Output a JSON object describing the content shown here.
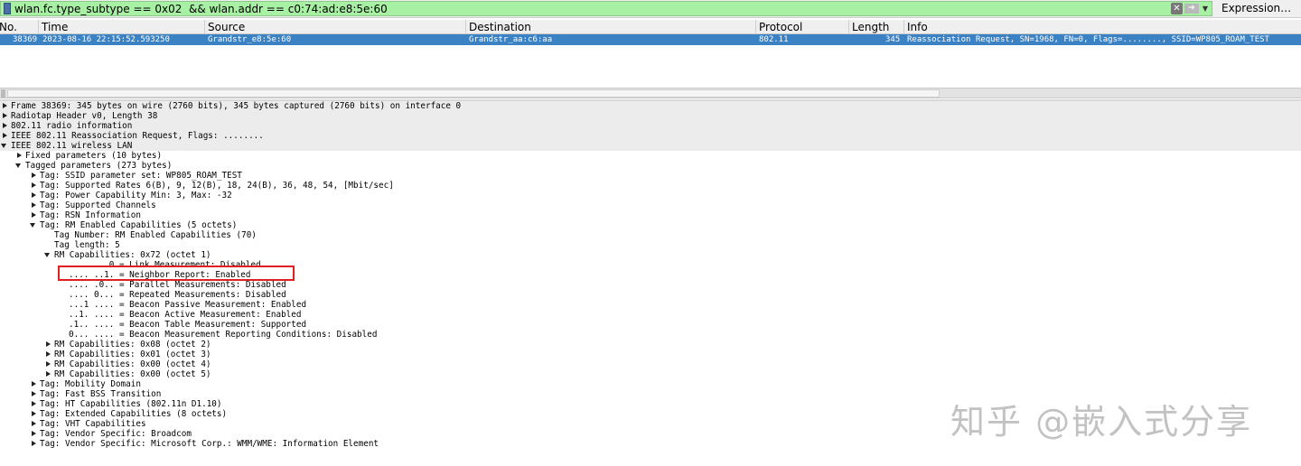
{
  "filter": {
    "value": "wlan.fc.type_subtype == 0x02  && wlan.addr == c0:74:ad:e8:5e:60",
    "expression_label": "Expression…"
  },
  "packet_list": {
    "columns": [
      "No.",
      "Time",
      "Source",
      "Destination",
      "Protocol",
      "Length",
      "Info"
    ],
    "rows": [
      {
        "no": "38369",
        "time": "2023-08-16 22:15:52.593250",
        "source": "Grandstr_e8:5e:60",
        "destination": "Grandstr_aa:c6:aa",
        "protocol": "802.11",
        "length": "345",
        "info": "Reassociation Request, SN=1968, FN=0, Flags=........, SSID=WP805_ROAM_TEST"
      }
    ]
  },
  "details": [
    {
      "text": "Frame 38369: 345 bytes on wire (2760 bits), 345 bytes captured (2760 bits) on interface 0",
      "arrow": "right",
      "level": 0
    },
    {
      "text": "Radiotap Header v0, Length 38",
      "arrow": "right",
      "level": 0
    },
    {
      "text": "802.11 radio information",
      "arrow": "right",
      "level": 0
    },
    {
      "text": "IEEE 802.11 Reassociation Request, Flags: ........",
      "arrow": "right",
      "level": 0
    },
    {
      "text": "IEEE 802.11 wireless LAN",
      "arrow": "down",
      "level": 0
    },
    {
      "text": "Fixed parameters (10 bytes)",
      "arrow": "right",
      "level": 1
    },
    {
      "text": "Tagged parameters (273 bytes)",
      "arrow": "down",
      "level": 1
    },
    {
      "text": "Tag: SSID parameter set: WP805_ROAM_TEST",
      "arrow": "right",
      "level": 2
    },
    {
      "text": "Tag: Supported Rates 6(B), 9, 12(B), 18, 24(B), 36, 48, 54, [Mbit/sec]",
      "arrow": "right",
      "level": 2
    },
    {
      "text": "Tag: Power Capability Min: 3, Max: -32",
      "arrow": "right",
      "level": 2
    },
    {
      "text": "Tag: Supported Channels",
      "arrow": "right",
      "level": 2
    },
    {
      "text": "Tag: RSN Information",
      "arrow": "right",
      "level": 2
    },
    {
      "text": "Tag: RM Enabled Capabilities (5 octets)",
      "arrow": "down",
      "level": 2
    },
    {
      "text": "Tag Number: RM Enabled Capabilities (70)",
      "arrow": "none",
      "level": 3
    },
    {
      "text": "Tag length: 5",
      "arrow": "none",
      "level": 3
    },
    {
      "text": "RM Capabilities: 0x72 (octet 1)",
      "arrow": "down",
      "level": 3
    },
    {
      "text": ".... ...0 = Link Measurement: Disabled",
      "arrow": "none",
      "level": 4
    },
    {
      "text": ".... ..1. = Neighbor Report: Enabled",
      "arrow": "none",
      "level": 4
    },
    {
      "text": ".... .0.. = Parallel Measurements: Disabled",
      "arrow": "none",
      "level": 4
    },
    {
      "text": ".... 0... = Repeated Measurements: Disabled",
      "arrow": "none",
      "level": 4
    },
    {
      "text": "...1 .... = Beacon Passive Measurement: Enabled",
      "arrow": "none",
      "level": 4
    },
    {
      "text": "..1. .... = Beacon Active Measurement: Enabled",
      "arrow": "none",
      "level": 4
    },
    {
      "text": ".1.. .... = Beacon Table Measurement: Supported",
      "arrow": "none",
      "level": 4
    },
    {
      "text": "0... .... = Beacon Measurement Reporting Conditions: Disabled",
      "arrow": "none",
      "level": 4
    },
    {
      "text": "RM Capabilities: 0x08 (octet 2)",
      "arrow": "right",
      "level": 3
    },
    {
      "text": "RM Capabilities: 0x01 (octet 3)",
      "arrow": "right",
      "level": 3
    },
    {
      "text": "RM Capabilities: 0x00 (octet 4)",
      "arrow": "right",
      "level": 3
    },
    {
      "text": "RM Capabilities: 0x00 (octet 5)",
      "arrow": "right",
      "level": 3
    },
    {
      "text": "Tag: Mobility Domain",
      "arrow": "right",
      "level": 2
    },
    {
      "text": "Tag: Fast BSS Transition",
      "arrow": "right",
      "level": 2
    },
    {
      "text": "Tag: HT Capabilities (802.11n D1.10)",
      "arrow": "right",
      "level": 2
    },
    {
      "text": "Tag: Extended Capabilities (8 octets)",
      "arrow": "right",
      "level": 2
    },
    {
      "text": "Tag: VHT Capabilities",
      "arrow": "right",
      "level": 2
    },
    {
      "text": "Tag: Vendor Specific: Broadcom",
      "arrow": "right",
      "level": 2
    },
    {
      "text": "Tag: Vendor Specific: Microsoft Corp.: WMM/WME: Information Element",
      "arrow": "right",
      "level": 2
    }
  ],
  "watermark": "知乎 @嵌入式分享",
  "colors": {
    "filter_valid": "#a8f0a4",
    "selection": "#3b82c4",
    "highlight_box": "#e02020"
  }
}
